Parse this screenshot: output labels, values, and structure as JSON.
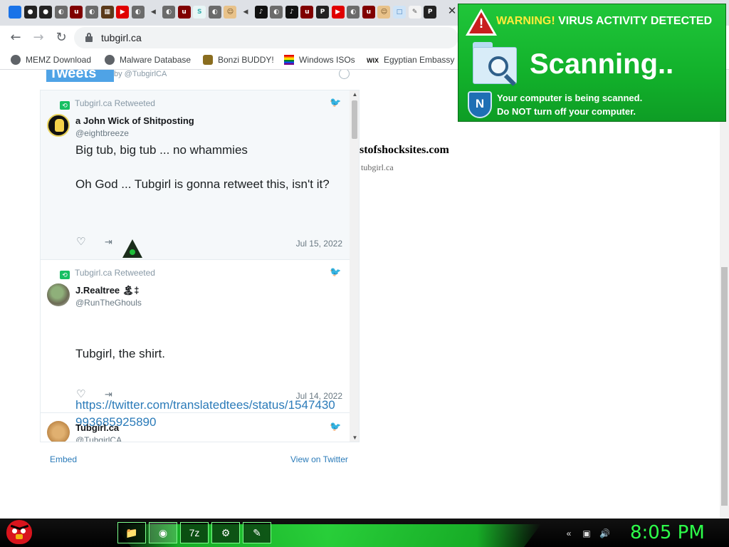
{
  "browser": {
    "tab_close_glyph": "✕",
    "tab_favicons": [
      {
        "icon": "download-icon",
        "glyph": "⬇",
        "color": "#1a73e8",
        "text": "#1a73e8"
      },
      {
        "icon": "github-icon",
        "glyph": "●",
        "color": "#222222",
        "text": "#ffffff"
      },
      {
        "icon": "github-icon",
        "glyph": "●",
        "color": "#222222",
        "text": "#ffffff"
      },
      {
        "icon": "globe-icon",
        "glyph": "◐",
        "color": "#6b6b6b",
        "text": "#ffffff"
      },
      {
        "icon": "ublock-icon",
        "glyph": "u",
        "color": "#800000",
        "text": "#ffffff"
      },
      {
        "icon": "globe-icon",
        "glyph": "◐",
        "color": "#6b6b6b",
        "text": "#ffffff"
      },
      {
        "icon": "film-icon",
        "glyph": "▦",
        "color": "#5a3a1a",
        "text": "#ffffff"
      },
      {
        "icon": "youtube-icon",
        "glyph": "▶",
        "color": "#e00000",
        "text": "#ffffff"
      },
      {
        "icon": "globe-icon",
        "glyph": "◐",
        "color": "#6b6b6b",
        "text": "#ffffff"
      },
      {
        "icon": "speaker-icon",
        "glyph": "◀",
        "color": "#dee1e6",
        "text": "#444444"
      },
      {
        "icon": "globe-icon",
        "glyph": "◐",
        "color": "#6b6b6b",
        "text": "#ffffff"
      },
      {
        "icon": "ublock-icon",
        "glyph": "u",
        "color": "#800000",
        "text": "#ffffff"
      },
      {
        "icon": "s-icon",
        "glyph": "S",
        "color": "#e8f6f6",
        "text": "#3ab0b0"
      },
      {
        "icon": "globe-icon",
        "glyph": "◐",
        "color": "#6b6b6b",
        "text": "#ffffff"
      },
      {
        "icon": "avatar-icon",
        "glyph": "☺",
        "color": "#e8c28a",
        "text": "#6b4a1f"
      },
      {
        "icon": "speaker-icon",
        "glyph": "◀",
        "color": "#dee1e6",
        "text": "#444444"
      },
      {
        "icon": "tiktok-icon",
        "glyph": "♪",
        "color": "#111111",
        "text": "#ffffff"
      },
      {
        "icon": "globe-icon",
        "glyph": "◐",
        "color": "#6b6b6b",
        "text": "#ffffff"
      },
      {
        "icon": "tiktok-icon",
        "glyph": "♪",
        "color": "#111111",
        "text": "#ffffff"
      },
      {
        "icon": "ublock-icon",
        "glyph": "u",
        "color": "#800000",
        "text": "#ffffff"
      },
      {
        "icon": "psn-icon",
        "glyph": "P",
        "color": "#222222",
        "text": "#ffffff"
      },
      {
        "icon": "youtube-icon",
        "glyph": "▶",
        "color": "#e00000",
        "text": "#ffffff"
      },
      {
        "icon": "globe-icon",
        "glyph": "◐",
        "color": "#6b6b6b",
        "text": "#ffffff"
      },
      {
        "icon": "ublock-icon",
        "glyph": "u",
        "color": "#800000",
        "text": "#ffffff"
      },
      {
        "icon": "avatar-icon",
        "glyph": "☺",
        "color": "#e8c28a",
        "text": "#6b4a1f"
      },
      {
        "icon": "window-icon",
        "glyph": "□",
        "color": "#cfe4f7",
        "text": "#3b7bbf"
      },
      {
        "icon": "paper-icon",
        "glyph": "✎",
        "color": "#f3f3f3",
        "text": "#555555"
      },
      {
        "icon": "psn-icon",
        "glyph": "P",
        "color": "#222222",
        "text": "#ffffff"
      }
    ],
    "nav": {
      "back": "←",
      "forward": "→",
      "reload": "↻"
    },
    "url": "tubgirl.ca",
    "bookmarks": [
      {
        "label": "MEMZ Download",
        "icon": "globe-icon",
        "color": "#5f6368"
      },
      {
        "label": "Malware Database",
        "icon": "globe-icon",
        "color": "#5f6368"
      },
      {
        "label": "Bonzi BUDDY!",
        "icon": "bonzi-icon",
        "color": "#8a6d1f"
      },
      {
        "label": "Windows ISOs",
        "icon": "rainbow-flag-icon",
        "color": "#e03030"
      },
      {
        "label": "Egyptian Embassy",
        "icon": "wix-icon",
        "color": "#111111"
      }
    ],
    "wix_glyph": "WIX"
  },
  "page": {
    "header_title": "Tweets",
    "header_by": "by @TubgirlCA",
    "timeline": [
      {
        "retweet_label": "Tubgirl.ca Retweeted",
        "name": "a John Wick of Shitposting",
        "handle": "@eightbreeze",
        "text": "Big tub, big tub ... no whammies\n\nOh God ... Tubgirl is gonna retweet this, isn't it?",
        "date": "Jul 15, 2022"
      },
      {
        "retweet_label": "Tubgirl.ca Retweeted",
        "name": "J.Realtree 🏝‡",
        "handle": "@RunTheGhouls",
        "text": "Tubgirl, the shirt.",
        "link": "https://twitter.com/translatedtees/status/1547430993685925890",
        "date": "Jul 14, 2022"
      },
      {
        "name": "Tubgirl.ca",
        "handle": "@TubgirlCA"
      }
    ],
    "embed_label": "Embed",
    "view_on_twitter_label": "View on Twitter",
    "site_title": "stofshocksites.com",
    "site_subtitle": "tubgirl.ca",
    "twitter_glyph": "🐦",
    "heart_glyph": "♡",
    "share_glyph": "⇥",
    "retweet_glyph": "⟲"
  },
  "popup": {
    "warning_label": "WARNING!",
    "warning_text": "VIRUS ACTIVITY DETECTED",
    "warning_mark": "!",
    "scanning_label": "Scanning..",
    "line1": "Your computer is being scanned.",
    "line2_pre": "Do ",
    "line2_bold": "NOT",
    "line2_post": " turn off your computer.",
    "shield_letter": "N",
    "colors": {
      "bg": "#17b52f",
      "accent_yellow": "#ffeb3b",
      "warn_red": "#c81e1e"
    }
  },
  "taskbar": {
    "buttons": [
      {
        "icon": "folder-icon",
        "glyph": "📁"
      },
      {
        "icon": "chrome-icon",
        "glyph": "◉"
      },
      {
        "icon": "7zip-icon",
        "glyph": "7z"
      },
      {
        "icon": "app-icon",
        "glyph": "⚙"
      },
      {
        "icon": "notepad-icon",
        "glyph": "✎"
      }
    ],
    "tray": [
      {
        "icon": "keyboard-icon",
        "glyph": "«"
      },
      {
        "icon": "network-icon",
        "glyph": "▣"
      },
      {
        "icon": "volume-icon",
        "glyph": "🔊"
      }
    ],
    "clock": "8:05 PM",
    "clock_color": "#2dff4a"
  }
}
